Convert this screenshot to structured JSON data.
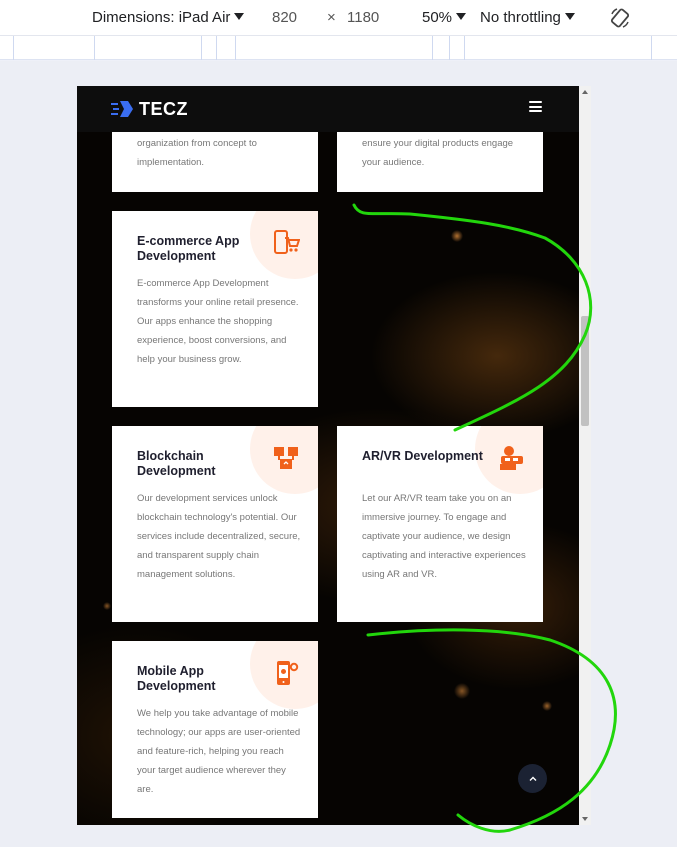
{
  "devtools": {
    "dimensions_label": "Dimensions: iPad Air",
    "width_value": "820",
    "times": "×",
    "height_value": "1180",
    "zoom": "50%",
    "throttling": "No throttling",
    "rotate_icon": "rotate-icon"
  },
  "site": {
    "logo_text": "TECZ",
    "menu_icon": "hamburger-icon"
  },
  "cards": {
    "top_left_text": "organization from concept to implementation.",
    "top_right_text": "ensure your digital products engage your audience.",
    "ecommerce": {
      "title": "E-commerce App Development",
      "text": "E-commerce App Development transforms your online retail presence. Our apps enhance the shopping experience, boost conversions, and help your business grow.",
      "icon": "cart-phone-icon"
    },
    "blockchain": {
      "title": "Blockchain Development",
      "text": "Our development services unlock blockchain technology's potential. Our services include decentralized, secure, and transparent supply chain management solutions.",
      "icon": "blockchain-icon"
    },
    "arvr": {
      "title": "AR/VR Development",
      "text": "Let our AR/VR team take you on an immersive journey. To engage and captivate your audience, we design captivating and interactive experiences using AR and VR.",
      "icon": "vr-headset-icon"
    },
    "mobile": {
      "title": "Mobile App Development",
      "text": "We help you take advantage of mobile technology; our apps are user-oriented and feature-rich, helping you reach your target audience wherever they are.",
      "icon": "mobile-gear-icon"
    }
  },
  "scroll_top_icon": "chevron-up-icon",
  "colors": {
    "accent": "#f0611b",
    "annotation": "#22d60c",
    "nav_bg": "#0d0d0d",
    "card_bg": "#ffffff"
  }
}
